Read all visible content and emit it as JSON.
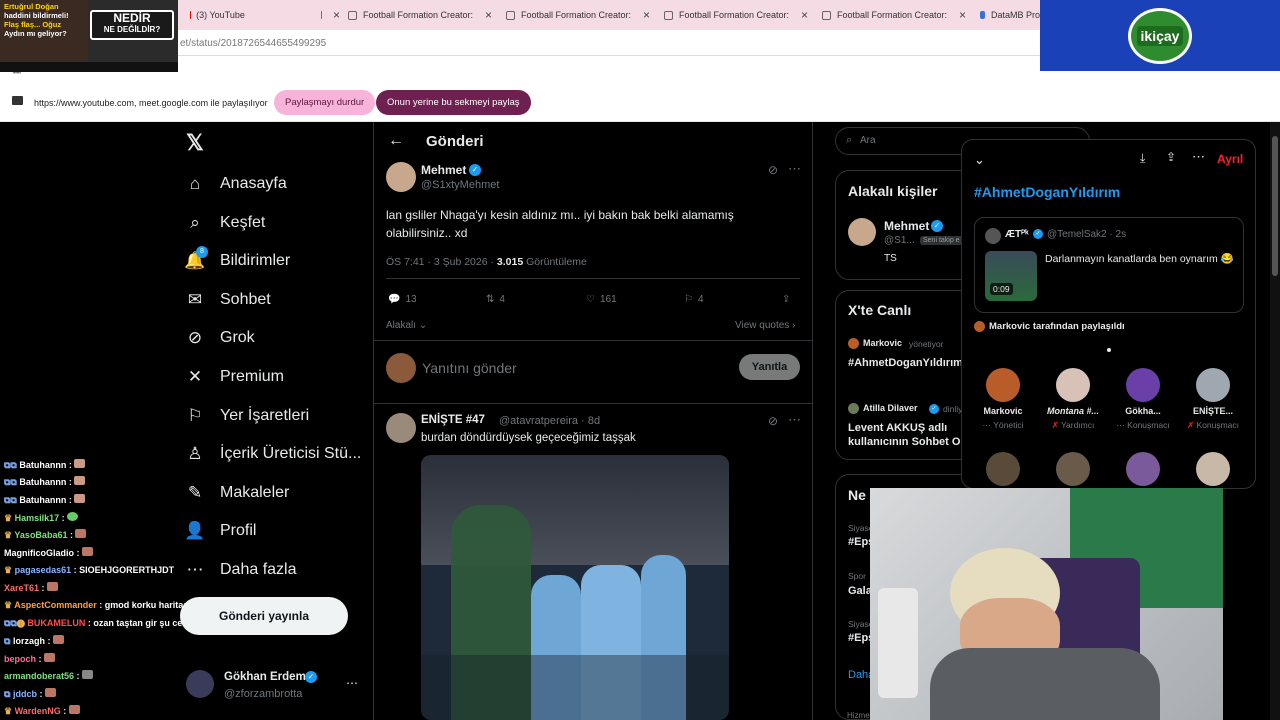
{
  "browser": {
    "tabs": [
      {
        "label": "(3) YouTube",
        "color": "#ff0000"
      },
      {
        "label": "Football Formation Creator: Re",
        "color": "#5a5a5a"
      },
      {
        "label": "Football Formation Creator: Re",
        "color": "#5a5a5a"
      },
      {
        "label": "Football Formation Creator: Re",
        "color": "#5a5a5a"
      },
      {
        "label": "Football Formation Creator: Re",
        "color": "#5a5a5a"
      },
      {
        "label": "DataMB Pro",
        "color": "#3b6fd8"
      }
    ],
    "url": "et/status/2018726544655499295",
    "share_text": "https://www.youtube.com, meet.google.com ile paylaşılıyor",
    "stop_sharing": "Paylaşmayı durdur",
    "share_this_tab": "Onun yerine bu sekmeyi paylaş"
  },
  "overlay": {
    "thumb_line1": "Ertuğrul Doğan",
    "thumb_line2": "haddini bildirmeli!",
    "thumb_line3": "Flaş flaş... Oğuz",
    "thumb_line4": "Aydın mı geliyor?",
    "thumb_badge1": "NEDİR",
    "thumb_badge2": "NE DEĞİLDİR?",
    "sponsor": "ikiçay"
  },
  "sidebar": {
    "items": [
      {
        "label": "Anasayfa",
        "icon": "home-icon",
        "glyph": "⌂"
      },
      {
        "label": "Keşfet",
        "icon": "search-icon",
        "glyph": "⌕"
      },
      {
        "label": "Bildirimler",
        "icon": "bell-icon",
        "glyph": "🔔"
      },
      {
        "label": "Sohbet",
        "icon": "mail-icon",
        "glyph": "✉"
      },
      {
        "label": "Grok",
        "icon": "grok-icon",
        "glyph": "⊘"
      },
      {
        "label": "Premium",
        "icon": "x-logo-icon",
        "glyph": "✕"
      },
      {
        "label": "Yer İşaretleri",
        "icon": "bookmark-icon",
        "glyph": "⚐"
      },
      {
        "label": "İçerik Üreticisi Stü...",
        "icon": "studio-icon",
        "glyph": "♙"
      },
      {
        "label": "Makaleler",
        "icon": "article-icon",
        "glyph": "✎"
      },
      {
        "label": "Profil",
        "icon": "person-icon",
        "glyph": "👤"
      },
      {
        "label": "Daha fazla",
        "icon": "more-icon",
        "glyph": "⋯"
      }
    ],
    "notif_badge": "8",
    "post_button": "Gönderi yayınla",
    "account_name": "Gökhan Erdem",
    "account_handle": "@zforzambrotta"
  },
  "chat": [
    {
      "user": "Batuhannn",
      "msg": "",
      "color": "#ffffff"
    },
    {
      "user": "Batuhannn",
      "msg": "",
      "color": "#ffffff"
    },
    {
      "user": "Batuhannn",
      "msg": "",
      "color": "#ffffff"
    },
    {
      "user": "Hamsilk17",
      "msg": "",
      "color": "#7fe07f"
    },
    {
      "user": "YasoBaba61",
      "msg": "",
      "color": "#7fe07f"
    },
    {
      "user": "MagnificoGladio",
      "msg": "",
      "color": "#ffffff"
    },
    {
      "user": "pagasedas61",
      "msg": "SIOEHJGORERTHJDT",
      "color": "#8ab4ff"
    },
    {
      "user": "XareT61",
      "msg": "",
      "color": "#ff6b6b"
    },
    {
      "user": "AspectCommander",
      "msg": "gmod korku haritası açtılar",
      "color": "#ff9f43"
    },
    {
      "user": "BUKAMELUN",
      "msg": "ozan taştan gir şu cesili cebrebi",
      "color": "#ff4d4d"
    },
    {
      "user": "lorzagh",
      "msg": "",
      "color": "#ffffff"
    },
    {
      "user": "bepoch",
      "msg": "",
      "color": "#ff6b9a"
    },
    {
      "user": "armandoberat56",
      "msg": "",
      "color": "#7fe07f"
    },
    {
      "user": "jddcb",
      "msg": "",
      "color": "#8ab4ff"
    },
    {
      "user": "WardenNG",
      "msg": "",
      "color": "#ff6b6b"
    }
  ],
  "post_view": {
    "header": "Gönderi",
    "author_name": "Mehmet",
    "author_handle": "@S1xtyMehmet",
    "text": "lan gsliler Nhaga'yı kesin aldınız mı.. iyi bakın bak belki alamamış olabilirsiniz.. xd",
    "time": "ÖS 7:41 · 3 Şub 2026 ·",
    "views": "3.015",
    "views_label": "Görüntüleme",
    "replies": "13",
    "retweets": "4",
    "likes": "161",
    "bookmarks": "4",
    "relevant": "Alakalı",
    "view_quotes": "View quotes",
    "reply_placeholder": "Yanıtını gönder",
    "reply_button": "Yanıtla",
    "reply2_name": "ENİŞTE #47",
    "reply2_handle": "@atavratpereira",
    "reply2_time": "· 8d",
    "reply2_text": "burdan döndürdüysek geçeceğimiz taşşak"
  },
  "right": {
    "search_placeholder": "Ara",
    "related_title": "Alakalı kişiler",
    "related_name": "Mehmet",
    "related_handle": "@S1...",
    "related_follow": "Seni takip e",
    "related_bio": "TS",
    "live_title": "X'te Canlı",
    "live1_user": "Markovic",
    "live1_role": "yönetiyor",
    "live1_title": "#AhmetDoganYıldırım",
    "live2_user": "Atilla Dilaver",
    "live2_role": "dinliy",
    "live2_title": "Levent AKKUŞ adlı kullanıcının Sohbet O",
    "news_title": "Ne",
    "news1_cat": "Siyase",
    "news1": "#Eps",
    "news2_cat": "Spor",
    "news2": "Gala",
    "news3_cat": "Siyase",
    "news3": "#Eps",
    "more": "Daha",
    "footer": "Hizme"
  },
  "space": {
    "leave": "Ayrıl",
    "title": "#AhmetDoganYıldırım",
    "pinned_name": "ÆTᴾᵏ",
    "pinned_handle": "@TemelSak2 · 2s",
    "pinned_text": "Darlanmayın kanatlarda ben oynarım 😂",
    "video_time": "0:09",
    "shared_by": "Markovic tarafından paylaşıldı",
    "speakers": [
      {
        "name": "Markovic",
        "role": "Yönetici",
        "color": "#b85c2a"
      },
      {
        "name": "Montana #...",
        "role": "Yardımcı",
        "color": "#d8c2b8"
      },
      {
        "name": "Gökha...",
        "role": "Konuşmacı",
        "color": "#6a3fa8"
      },
      {
        "name": "ENİŞTE...",
        "role": "Konuşmacı",
        "color": "#9fa8b0"
      }
    ]
  }
}
